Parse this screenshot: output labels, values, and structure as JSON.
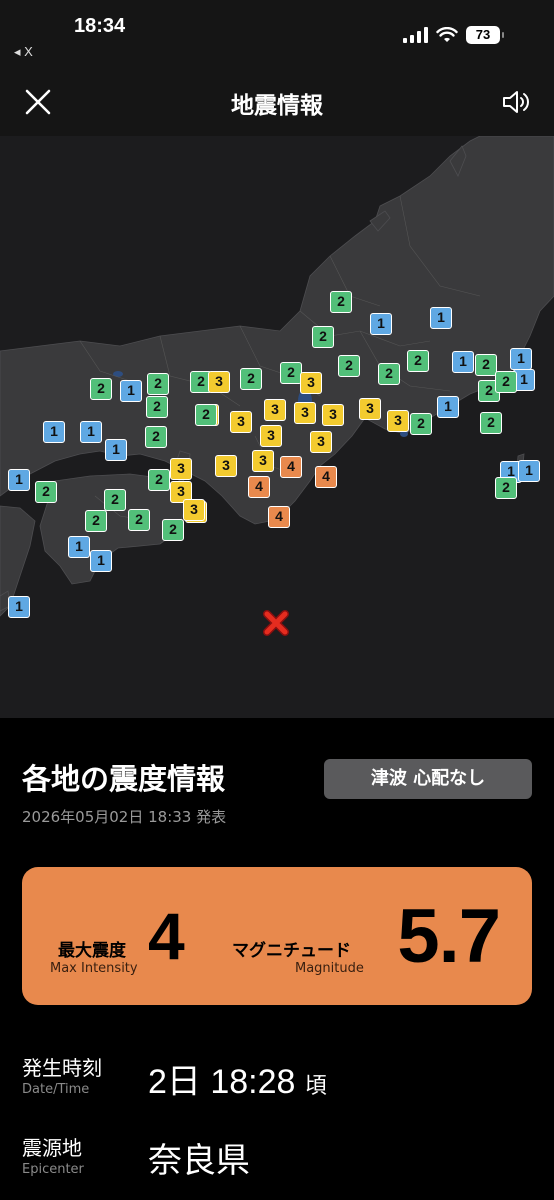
{
  "status_bar": {
    "time": "18:34",
    "back_label": "◂ X",
    "battery": "73"
  },
  "header": {
    "title": "地震情報",
    "close_icon": "close-icon",
    "sound_icon": "speaker-icon"
  },
  "map": {
    "markers": [
      {
        "i": "2"
      },
      {
        "i": "1"
      },
      {
        "i": "1"
      },
      {
        "i": "2"
      },
      {
        "i": "2"
      },
      {
        "i": "1"
      },
      {
        "i": "2"
      },
      {
        "i": "2"
      },
      {
        "i": "2"
      },
      {
        "i": "1"
      },
      {
        "i": "2"
      },
      {
        "i": "1"
      },
      {
        "i": "2"
      },
      {
        "i": "2"
      },
      {
        "i": "3"
      },
      {
        "i": "2"
      },
      {
        "i": "2"
      },
      {
        "i": "3"
      },
      {
        "i": "2"
      },
      {
        "i": "2"
      },
      {
        "i": "2"
      },
      {
        "i": "1"
      },
      {
        "i": "1"
      },
      {
        "i": "1"
      },
      {
        "i": "2"
      },
      {
        "i": "3"
      },
      {
        "i": "3"
      },
      {
        "i": "3"
      },
      {
        "i": "3"
      },
      {
        "i": "3"
      },
      {
        "i": "3"
      },
      {
        "i": "2"
      },
      {
        "i": "2"
      },
      {
        "i": "1"
      },
      {
        "i": "2"
      },
      {
        "i": "3"
      },
      {
        "i": "3"
      },
      {
        "i": "3"
      },
      {
        "i": "3"
      },
      {
        "i": "1"
      },
      {
        "i": "2"
      },
      {
        "i": "1"
      },
      {
        "i": "3"
      },
      {
        "i": "3"
      },
      {
        "i": "4"
      },
      {
        "i": "1"
      },
      {
        "i": "1"
      },
      {
        "i": "2"
      },
      {
        "i": "4"
      },
      {
        "i": "4"
      },
      {
        "i": "2"
      },
      {
        "i": "3"
      },
      {
        "i": "3"
      },
      {
        "i": "2"
      },
      {
        "i": "2"
      },
      {
        "i": "2"
      },
      {
        "i": "3"
      },
      {
        "i": "4"
      },
      {
        "i": "1"
      },
      {
        "i": "2"
      },
      {
        "i": "1"
      },
      {
        "i": "1"
      },
      {
        "i": "1"
      }
    ]
  },
  "info": {
    "section_title": "各地の震度情報",
    "tsunami": "津波 心配なし",
    "issued": "2026年05月02日 18:33 発表",
    "max_intensity_label": "最大震度",
    "max_intensity_sub": "Max Intensity",
    "max_intensity": "4",
    "magnitude_label": "マグニチュード",
    "magnitude_sub": "Magnitude",
    "magnitude": "5.7",
    "datetime_label": "発生時刻",
    "datetime_sub": "Date/Time",
    "datetime_value": "2日 18:28",
    "datetime_suffix": "頃",
    "epicenter_label": "震源地",
    "epicenter_sub": "Epicenter",
    "epicenter_value": "奈良県",
    "colors": {
      "i1": "#5fa8e3",
      "i2": "#52bf79",
      "i3": "#f3cb2f",
      "i4": "#e8894d"
    }
  }
}
